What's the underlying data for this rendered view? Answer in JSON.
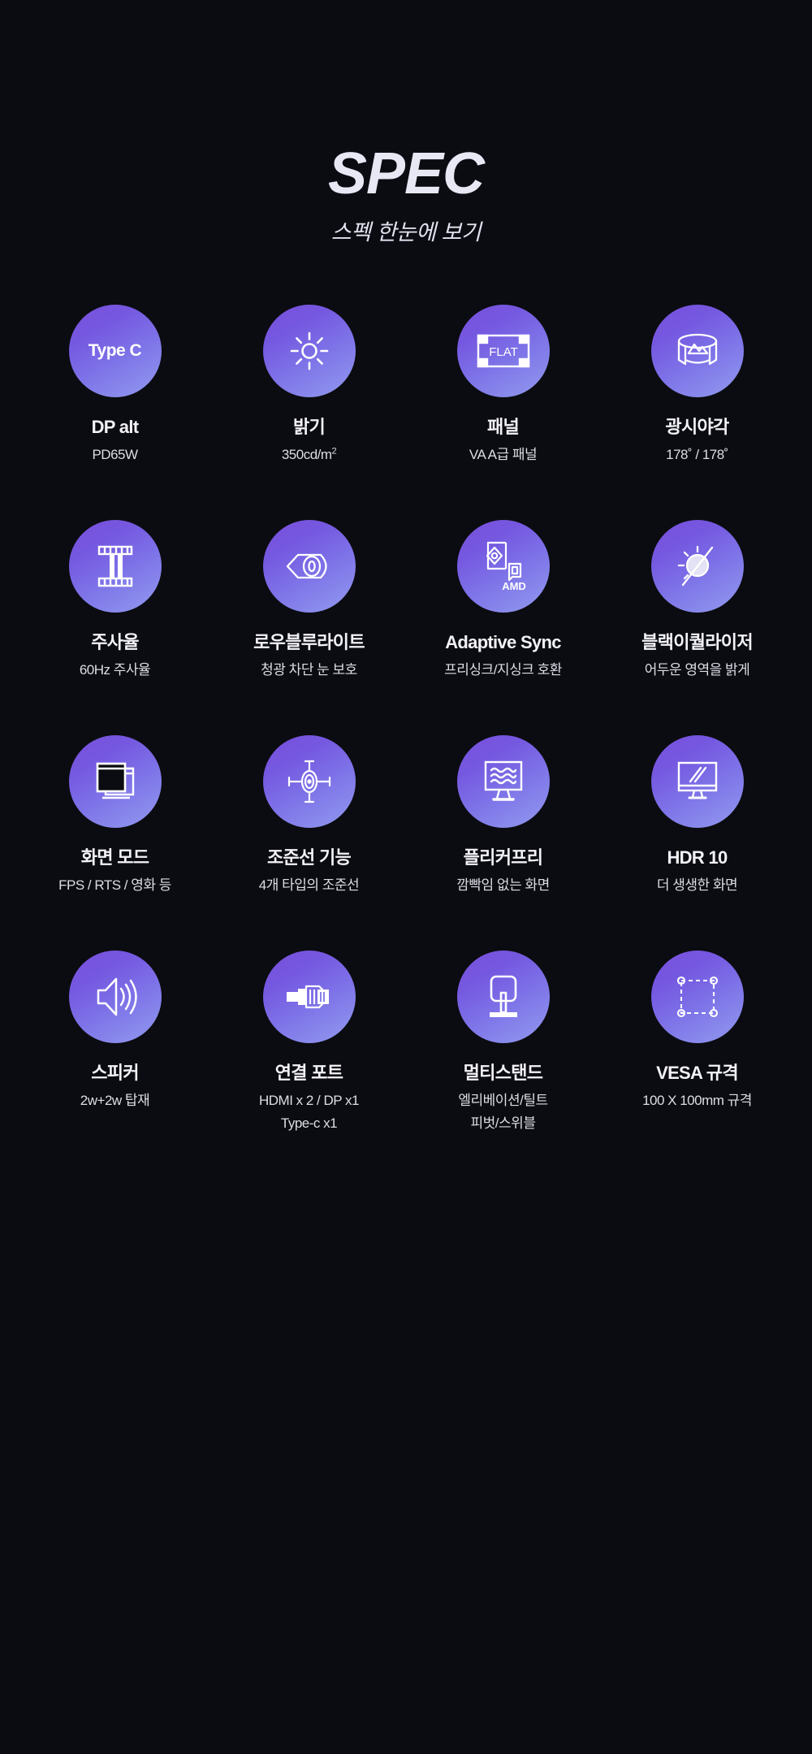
{
  "header": {
    "title": "SPEC",
    "subtitle": "스펙 한눈에 보기"
  },
  "colors": {
    "background": "#0B0C11",
    "bubble_top": "#7A4FDC",
    "bubble_bottom": "#929BEF",
    "title_text": "#E8E8F5",
    "body_text": "#DDDDE6"
  },
  "specs": [
    {
      "icon": "type-c-text-icon",
      "bubble_text": "Type C",
      "title": "DP alt",
      "desc": "PD65W",
      "desc2": ""
    },
    {
      "icon": "brightness-sun-icon",
      "bubble_text": "",
      "title": "밝기",
      "desc": "350cd/m",
      "desc_sup": "2",
      "desc2": ""
    },
    {
      "icon": "flat-panel-icon",
      "bubble_text": "FLAT",
      "title": "패널",
      "desc": "VA A급 패널",
      "desc2": ""
    },
    {
      "icon": "wide-view-angle-icon",
      "bubble_text": "",
      "title": "광시야각",
      "desc": "178˚ / 178˚",
      "desc2": ""
    },
    {
      "icon": "film-strip-refresh-icon",
      "bubble_text": "",
      "title": "주사율",
      "desc": "60Hz 주사율",
      "desc2": ""
    },
    {
      "icon": "eye-low-blue-light-icon",
      "bubble_text": "",
      "title": "로우블루라이트",
      "desc": "청광 차단 눈 보호",
      "desc2": ""
    },
    {
      "icon": "amd-adaptive-sync-icon",
      "bubble_text": "AMD",
      "title": "Adaptive Sync",
      "desc": "프리싱크/지싱크 호환",
      "desc2": ""
    },
    {
      "icon": "black-equalizer-icon",
      "bubble_text": "",
      "title": "블랙이퀄라이저",
      "desc": "어두운 영역을 밝게",
      "desc2": ""
    },
    {
      "icon": "screen-mode-windows-icon",
      "bubble_text": "",
      "title": "화면 모드",
      "desc": "FPS / RTS / 영화 등",
      "desc2": ""
    },
    {
      "icon": "crosshair-aim-icon",
      "bubble_text": "",
      "title": "조준선 기능",
      "desc": "4개 타입의 조준선",
      "desc2": ""
    },
    {
      "icon": "flicker-free-monitor-icon",
      "bubble_text": "",
      "title": "플리커프리",
      "desc": "깜빡임 없는 화면",
      "desc2": ""
    },
    {
      "icon": "hdr-monitor-icon",
      "bubble_text": "",
      "title": "HDR 10",
      "desc": "더 생생한 화면",
      "desc2": ""
    },
    {
      "icon": "speaker-icon",
      "bubble_text": "",
      "title": "스피커",
      "desc": "2w+2w 탑재",
      "desc2": ""
    },
    {
      "icon": "hdmi-connector-icon",
      "bubble_text": "",
      "title": "연결 포트",
      "desc": "HDMI x 2 / DP x1",
      "desc2": "Type-c x1"
    },
    {
      "icon": "multi-stand-icon",
      "bubble_text": "",
      "title": "멀티스탠드",
      "desc": "엘리베이션/틸트",
      "desc2": "피벗/스위블"
    },
    {
      "icon": "vesa-mount-icon",
      "bubble_text": "",
      "title": "VESA 규격",
      "desc": "100 X 100mm 규격",
      "desc2": ""
    }
  ]
}
